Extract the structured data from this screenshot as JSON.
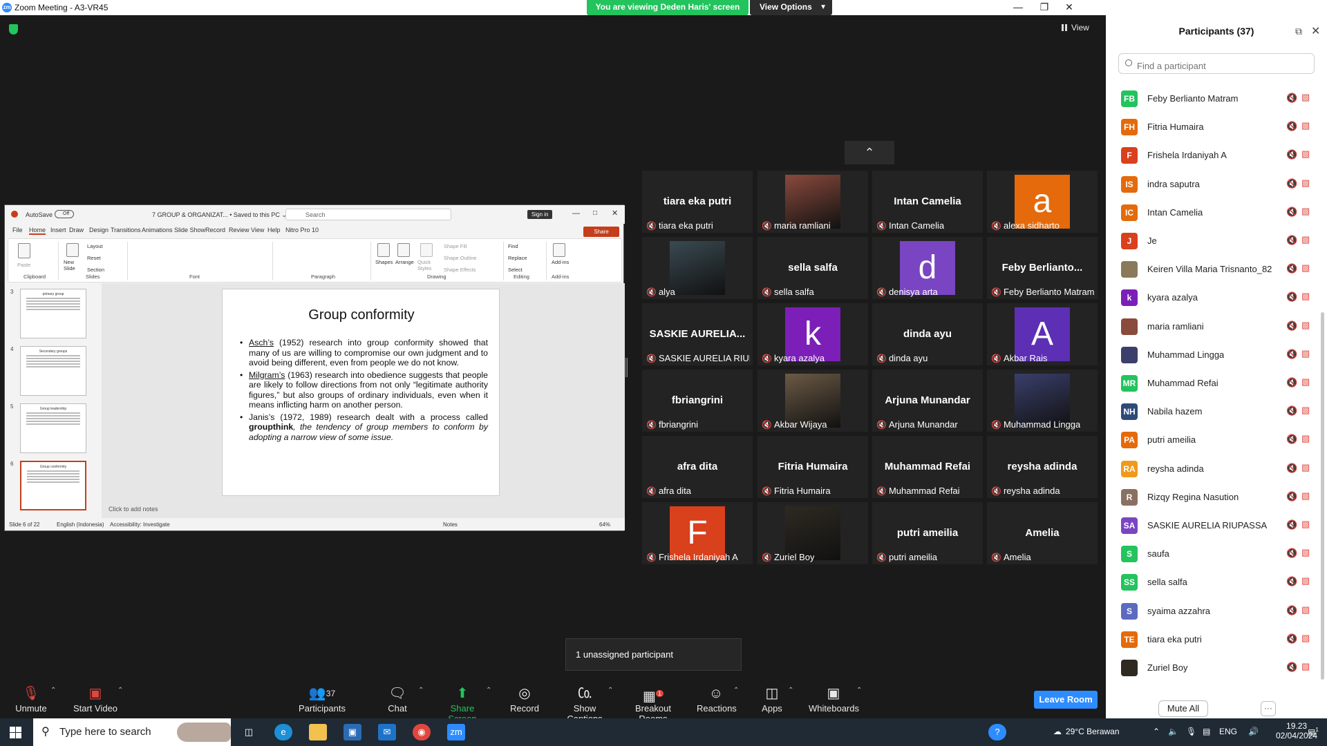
{
  "window": {
    "title": "Zoom Meeting - A3-VR45",
    "viewing_banner": "You are viewing Deden Haris' screen",
    "view_options": "View Options",
    "view_button": "View"
  },
  "ppt": {
    "autosave": "AutoSave",
    "autosave_state": "Off",
    "filename": "7 GROUP & ORGANIZAT... • Saved to this PC ⌄",
    "search_placeholder": "Search",
    "signin": "Sign in",
    "share": "Share",
    "tabs": [
      "File",
      "Home",
      "Insert",
      "Draw",
      "Design",
      "Transitions",
      "Animations",
      "Slide Show",
      "Record",
      "Review",
      "View",
      "Help",
      "Nitro Pro 10"
    ],
    "active_tab": "Home",
    "ribbon_groups": [
      "Clipboard",
      "Slides",
      "Font",
      "Paragraph",
      "Drawing",
      "Editing",
      "Add-ins"
    ],
    "ribbon_labels": {
      "paste": "Paste",
      "new_slide": "New Slide",
      "layout": "Layout",
      "reset": "Reset",
      "section": "Section",
      "shapes": "Shapes",
      "arrange": "Arrange",
      "quick_styles": "Quick Styles",
      "shape_fill": "Shape Fill",
      "shape_outline": "Shape Outline",
      "shape_effects": "Shape Effects",
      "find": "Find",
      "replace": "Replace",
      "select": "Select",
      "addins": "Add-ins"
    },
    "thumbnails": [
      {
        "num": "3",
        "title": "primary group"
      },
      {
        "num": "4",
        "title": "Secondary groups"
      },
      {
        "num": "5",
        "title": "Group leadership"
      },
      {
        "num": "6",
        "title": "Group conformity"
      }
    ],
    "slide_title": "Group conformity",
    "bullets": [
      {
        "lead": "Asch’s",
        "text": " (1952) research into group conformity showed that many of us are willing to compromise our own judgment and to avoid being different, even from people we do not know."
      },
      {
        "lead": "Milgram’s",
        "text": " (1963) research into obedience suggests that people are likely to follow directions from not only “legitimate authority figures,” but also groups of ordinary individuals, even when it means inflicting harm on another person."
      },
      {
        "lead": "Janis’s",
        "text": " (1972, 1989) research dealt with a process called ",
        "bold": "groupthink",
        "italic": ", the tendency of group members to conform by adopting a narrow view of some issue."
      }
    ],
    "notes": "Click to add notes",
    "status": {
      "slide": "Slide 6 of 22",
      "language": "English (Indonesia)",
      "accessibility": "Accessibility: Investigate",
      "notes_btn": "Notes",
      "zoom": "64%"
    }
  },
  "gallery": [
    {
      "big": "tiara eka putri",
      "name": "tiara eka putri",
      "avatar": "",
      "color": ""
    },
    {
      "big": "",
      "name": "maria ramliani",
      "avatar": "photo",
      "color": "#8a4a3c"
    },
    {
      "big": "Intan Camelia",
      "name": "Intan Camelia",
      "avatar": "",
      "color": ""
    },
    {
      "big": "",
      "name": "alexa sidharto",
      "avatar": "a",
      "color": "#e46a0b"
    },
    {
      "big": "",
      "name": "alya",
      "avatar": "photo",
      "color": "#3a4a52"
    },
    {
      "big": "sella salfa",
      "name": "sella salfa",
      "avatar": "",
      "color": ""
    },
    {
      "big": "",
      "name": "denisya arta",
      "avatar": "d",
      "color": "#7a45c2"
    },
    {
      "big": "Feby Berlianto...",
      "name": "Feby Berlianto Matram",
      "avatar": "",
      "color": ""
    },
    {
      "big": "SASKIE AURELIA...",
      "name": "SASKIE AURELIA RIUP...",
      "avatar": "",
      "color": ""
    },
    {
      "big": "",
      "name": "kyara azalya",
      "avatar": "k",
      "color": "#7c1fb8"
    },
    {
      "big": "dinda ayu",
      "name": "dinda ayu",
      "avatar": "",
      "color": ""
    },
    {
      "big": "",
      "name": "Akbar Rais",
      "avatar": "A",
      "color": "#5c2fb5"
    },
    {
      "big": "fbriangrini",
      "name": "fbriangrini",
      "avatar": "",
      "color": ""
    },
    {
      "big": "",
      "name": "Akbar Wijaya",
      "avatar": "photo",
      "color": "#6b5a45"
    },
    {
      "big": "Arjuna Munandar",
      "name": "Arjuna Munandar",
      "avatar": "",
      "color": ""
    },
    {
      "big": "",
      "name": "Muhammad Lingga",
      "avatar": "photo",
      "color": "#3a3f6b"
    },
    {
      "big": "afra dita",
      "name": "afra dita",
      "avatar": "",
      "color": ""
    },
    {
      "big": "Fitria Humaira",
      "name": "Fitria Humaira",
      "avatar": "",
      "color": ""
    },
    {
      "big": "Muhammad Refai",
      "name": "Muhammad Refai",
      "avatar": "",
      "color": ""
    },
    {
      "big": "reysha adinda",
      "name": "reysha adinda",
      "avatar": "",
      "color": ""
    },
    {
      "big": "",
      "name": "Frishela Irdaniyah A",
      "avatar": "F",
      "color": "#d9401c"
    },
    {
      "big": "",
      "name": "Zuriel Boy",
      "avatar": "photo",
      "color": "#2e2a22"
    },
    {
      "big": "putri ameilia",
      "name": "putri ameilia",
      "avatar": "",
      "color": ""
    },
    {
      "big": "Amelia",
      "name": "Amelia",
      "avatar": "",
      "color": ""
    }
  ],
  "unassigned": "1 unassigned participant",
  "toolbar": {
    "unmute": "Unmute",
    "start_video": "Start Video",
    "participants": "Participants",
    "participants_count": "37",
    "chat": "Chat",
    "share_screen": "Share Screen",
    "record": "Record",
    "show_captions": "Show Captions",
    "breakout_rooms": "Breakout Rooms",
    "breakout_badge": "1",
    "reactions": "Reactions",
    "apps": "Apps",
    "whiteboards": "Whiteboards",
    "leave": "Leave Room"
  },
  "panel": {
    "title": "Participants (37)",
    "find_placeholder": "Find a participant",
    "participants": [
      {
        "initials": "FB",
        "name": "Feby Berlianto Matram",
        "color": "#23c35d"
      },
      {
        "initials": "FH",
        "name": "Fitria Humaira",
        "color": "#e46a0b"
      },
      {
        "initials": "F",
        "name": "Frishela Irdaniyah A",
        "color": "#d9401c"
      },
      {
        "initials": "IS",
        "name": "indra saputra",
        "color": "#e46a0b"
      },
      {
        "initials": "IC",
        "name": "Intan Camelia",
        "color": "#e46a0b"
      },
      {
        "initials": "J",
        "name": "Je",
        "color": "#d9401c"
      },
      {
        "initials": "",
        "name": "Keiren Villa Maria Trisnanto_82...",
        "color": "#8a7a5a"
      },
      {
        "initials": "k",
        "name": "kyara azalya",
        "color": "#7c1fb8"
      },
      {
        "initials": "",
        "name": "maria ramliani",
        "color": "#8a4a3c"
      },
      {
        "initials": "",
        "name": "Muhammad Lingga",
        "color": "#3a3f6b"
      },
      {
        "initials": "MR",
        "name": "Muhammad Refai",
        "color": "#23c35d"
      },
      {
        "initials": "NH",
        "name": "Nabila hazem",
        "color": "#2d4a7a"
      },
      {
        "initials": "PA",
        "name": "putri ameilia",
        "color": "#e46a0b"
      },
      {
        "initials": "RA",
        "name": "reysha adinda",
        "color": "#f09a1c"
      },
      {
        "initials": "R",
        "name": "Rizqy Regina Nasution",
        "color": "#8a7060"
      },
      {
        "initials": "SA",
        "name": "SASKIE AURELIA RIUPASSA",
        "color": "#7a45c2"
      },
      {
        "initials": "S",
        "name": "saufa",
        "color": "#23c35d"
      },
      {
        "initials": "SS",
        "name": "sella salfa",
        "color": "#23c35d"
      },
      {
        "initials": "S",
        "name": "syaima azzahra",
        "color": "#5c6bc0"
      },
      {
        "initials": "TE",
        "name": "tiara eka putri",
        "color": "#e46a0b"
      },
      {
        "initials": "",
        "name": "Zuriel Boy",
        "color": "#2e2a22"
      }
    ],
    "mute_all": "Mute All",
    "more": "···"
  },
  "taskbar": {
    "search_placeholder": "Type here to search",
    "weather": "29°C  Berawan",
    "lang": "ENG",
    "time": "19.23",
    "date": "02/04/2024",
    "notif_count": "1"
  },
  "colors": {
    "zoom_blue": "#2d8cff",
    "banner_green": "#23c35d",
    "muted_red": "#e0463e",
    "ppt_accent": "#c43e1c"
  }
}
